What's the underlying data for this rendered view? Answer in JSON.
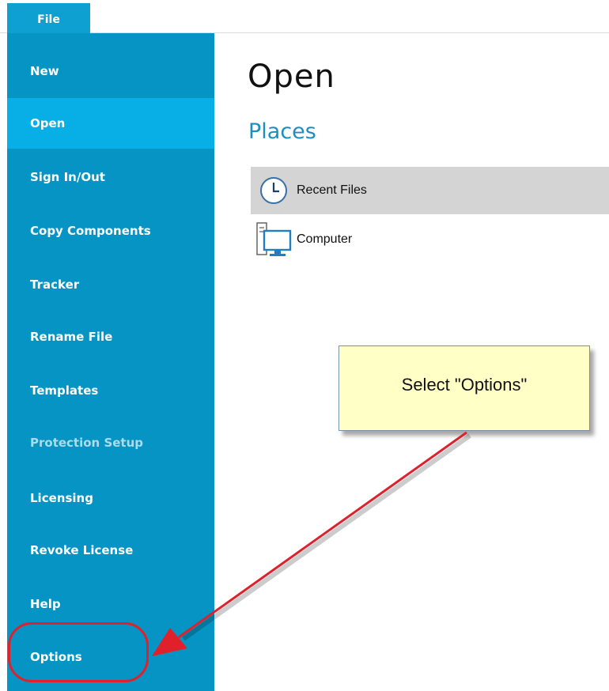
{
  "tabs": {
    "file": "File"
  },
  "sidebar": {
    "items": [
      {
        "label": "New",
        "state": "normal"
      },
      {
        "label": "Open",
        "state": "active"
      },
      {
        "label": "Sign In/Out",
        "state": "normal"
      },
      {
        "label": "Copy Components",
        "state": "normal"
      },
      {
        "label": "Tracker",
        "state": "normal"
      },
      {
        "label": "Rename File",
        "state": "normal"
      },
      {
        "label": "Templates",
        "state": "normal"
      },
      {
        "label": "Protection Setup",
        "state": "disabled"
      },
      {
        "label": "Licensing",
        "state": "normal"
      },
      {
        "label": "Revoke License",
        "state": "normal"
      },
      {
        "label": "Help",
        "state": "normal"
      },
      {
        "label": "Options",
        "state": "normal"
      }
    ]
  },
  "main": {
    "title": "Open",
    "section": "Places",
    "places": [
      {
        "label": "Recent Files",
        "icon": "clock-icon",
        "selected": true
      },
      {
        "label": "Computer",
        "icon": "computer-icon",
        "selected": false
      }
    ]
  },
  "annotation": {
    "callout_text": "Select \"Options\""
  },
  "colors": {
    "sidebar": "#0594c4",
    "sidebar_active": "#08aee6",
    "file_tab": "#0fa0d2",
    "section_title": "#1b8fc0",
    "callout_bg": "#ffffc6",
    "arrow": "#e0202a"
  }
}
